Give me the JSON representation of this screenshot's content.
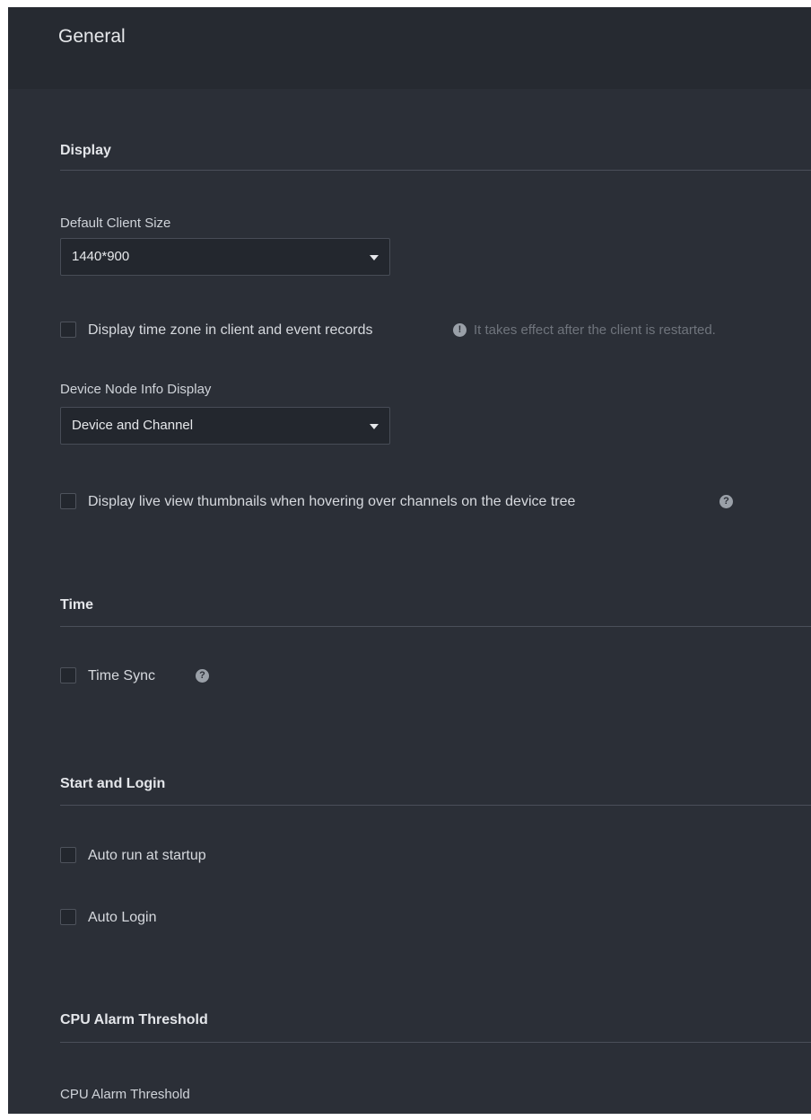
{
  "page": {
    "title": "General"
  },
  "display": {
    "section_title": "Display",
    "client_size": {
      "label": "Default Client Size",
      "value": "1440*900"
    },
    "timezone": {
      "label": "Display time zone in client and event records",
      "checked": false,
      "hint_icon": "exclamation-circle-icon",
      "hint": "It takes effect after the client is restarted."
    },
    "node_info": {
      "label": "Device Node Info Display",
      "value": "Device and Channel"
    },
    "thumbnails": {
      "label": "Display live view thumbnails when hovering over channels on the device tree",
      "checked": false,
      "help_icon": "question-circle-icon"
    }
  },
  "time": {
    "section_title": "Time",
    "time_sync": {
      "label": "Time Sync",
      "checked": false,
      "help_icon": "question-circle-icon"
    }
  },
  "start_login": {
    "section_title": "Start and Login",
    "auto_run": {
      "label": "Auto run at startup",
      "checked": false
    },
    "auto_login": {
      "label": "Auto Login",
      "checked": false
    }
  },
  "cpu": {
    "section_title": "CPU Alarm Threshold",
    "field_label": "CPU Alarm Threshold"
  },
  "colors": {
    "background": "#2b2f37",
    "header": "#262a31",
    "divider": "#4a4f59",
    "text": "#e4e6ea",
    "hint_text": "#6f747c"
  }
}
